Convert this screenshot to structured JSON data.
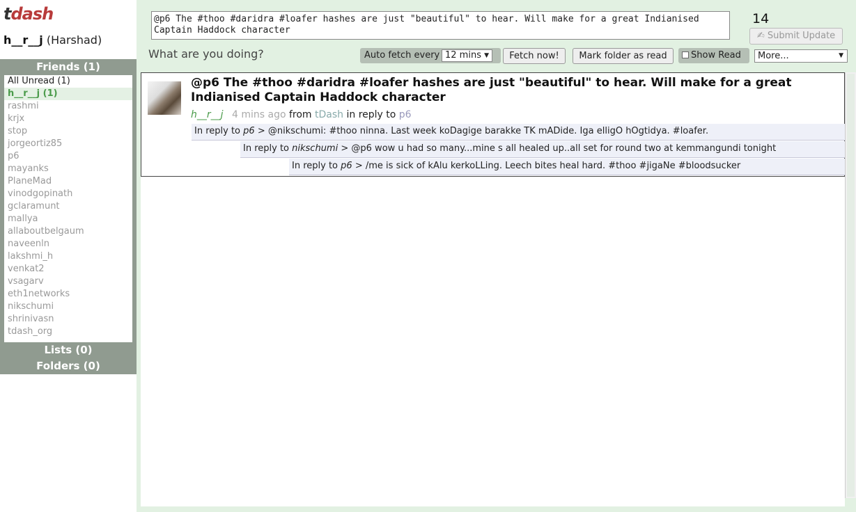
{
  "app": {
    "logo_t": "t",
    "logo_rest": "dash"
  },
  "user": {
    "handle": "h__r__j",
    "name": "(Harshad)"
  },
  "sidebar": {
    "friends_header": "Friends (1)",
    "lists_header": "Lists (0)",
    "folders_header": "Folders (0)",
    "items": [
      {
        "label": "All Unread (1)"
      },
      {
        "label": "h__r__j (1)"
      },
      {
        "label": "rashmi"
      },
      {
        "label": "krjx"
      },
      {
        "label": "stop"
      },
      {
        "label": "jorgeortiz85"
      },
      {
        "label": "p6"
      },
      {
        "label": "mayanks"
      },
      {
        "label": "PlaneMad"
      },
      {
        "label": "vinodgopinath"
      },
      {
        "label": "gclaramunt"
      },
      {
        "label": "mallya"
      },
      {
        "label": "allaboutbelgaum"
      },
      {
        "label": "naveenln"
      },
      {
        "label": "lakshmi_h"
      },
      {
        "label": "venkat2"
      },
      {
        "label": "vsagarv"
      },
      {
        "label": "eth1networks"
      },
      {
        "label": "nikschumi"
      },
      {
        "label": "shrinivasn"
      },
      {
        "label": "tdash_org"
      }
    ]
  },
  "composer": {
    "value": "@p6 The #thoo #daridra #loafer hashes are just \"beautiful\" to hear. Will make for a great Indianised Captain Haddock character",
    "char_count": "14",
    "submit_label": "✍ Submit Update",
    "prompt": "What are you doing?"
  },
  "toolbar": {
    "auto_fetch_label": "Auto fetch every",
    "interval_value": "12 mins",
    "fetch_now_label": "Fetch now!",
    "mark_read_label": "Mark folder as read",
    "show_read_label": "Show Read",
    "more_label": "More..."
  },
  "tweet": {
    "text": "@p6 The #thoo #daridra #loafer hashes are just \"beautiful\" to hear. Will make for a great Indianised Captain Haddock character",
    "author": "h__r__j",
    "time": "4 mins ago",
    "from_label": "from",
    "source": "tDash",
    "in_reply_label": "in reply to",
    "reply_to": "p6",
    "replies": [
      {
        "prefix": "In reply to",
        "user": "p6",
        "sep": ">",
        "text": "@nikschumi: #thoo ninna. Last week koDagige barakke TK mADide. Iga elligO hOgtidya. #loafer."
      },
      {
        "prefix": "In reply to",
        "user": "nikschumi",
        "sep": ">",
        "text": "@p6 wow u had so many...mine s all healed up..all set for round two at kemmangundi tonight"
      },
      {
        "prefix": "In reply to",
        "user": "p6",
        "sep": ">",
        "text": "/me is sick of kAlu kerkoLLing. Leech bites heal hard. #thoo #jigaNe #bloodsucker"
      }
    ]
  },
  "colors": {
    "background": "#e2f1e2",
    "sidebar_header": "#909b90",
    "logo_accent": "#b83b3b",
    "selected_friend": "#4a9b4a"
  }
}
